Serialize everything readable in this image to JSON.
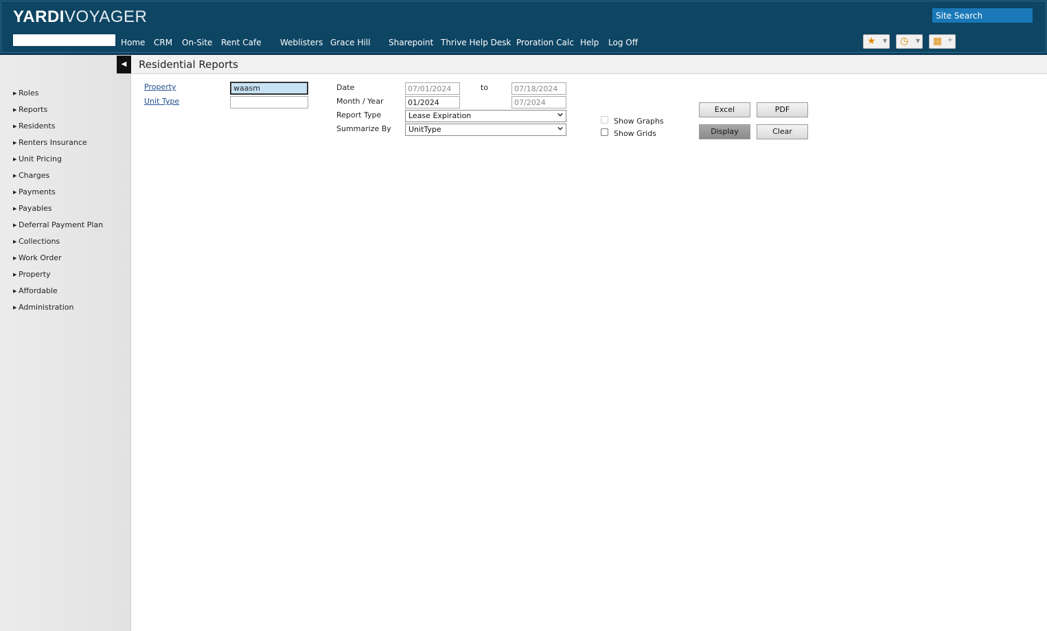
{
  "header": {
    "logo_bold": "YARDI",
    "logo_light": "VOYAGER",
    "search_placeholder": "Site Search",
    "nav": [
      "Home",
      "CRM",
      "On-Site",
      "Rent Cafe",
      "Weblisters",
      "Grace Hill",
      "Sharepoint",
      "Thrive Help Desk",
      "Proration Calc",
      "Help",
      "Log Off"
    ],
    "tools": [
      {
        "icon": "star-icon",
        "glyph": "★"
      },
      {
        "icon": "clock-icon",
        "glyph": "◷"
      },
      {
        "icon": "grid-icon",
        "glyph": "▦"
      }
    ]
  },
  "sidebar": {
    "items": [
      "Roles",
      "Reports",
      "Residents",
      "Renters Insurance",
      "Unit Pricing",
      "Charges",
      "Payments",
      "Payables",
      "Deferral Payment Plan",
      "Collections",
      "Work Order",
      "Property",
      "Affordable",
      "Administration"
    ]
  },
  "page": {
    "title": "Residential Reports"
  },
  "form": {
    "property_label": "Property",
    "property_value": "waasm",
    "unit_type_label": "Unit Type",
    "unit_type_value": "",
    "date_label": "Date",
    "date_from": "07/01/2024",
    "to_label": "to",
    "date_to": "07/18/2024",
    "month_year_label": "Month / Year",
    "month_from": "01/2024",
    "month_to": "07/2024",
    "report_type_label": "Report Type",
    "report_type_value": "Lease Expiration",
    "summarize_by_label": "Summarize By",
    "summarize_by_value": "UnitType",
    "show_graphs_label": "Show Graphs",
    "show_grids_label": "Show Grids"
  },
  "buttons": {
    "excel": "Excel",
    "pdf": "PDF",
    "display": "Display",
    "clear": "Clear"
  },
  "colors": {
    "header_bg": "#0e4563",
    "search_bg": "#1a78b8",
    "link": "#1f4e8c"
  }
}
